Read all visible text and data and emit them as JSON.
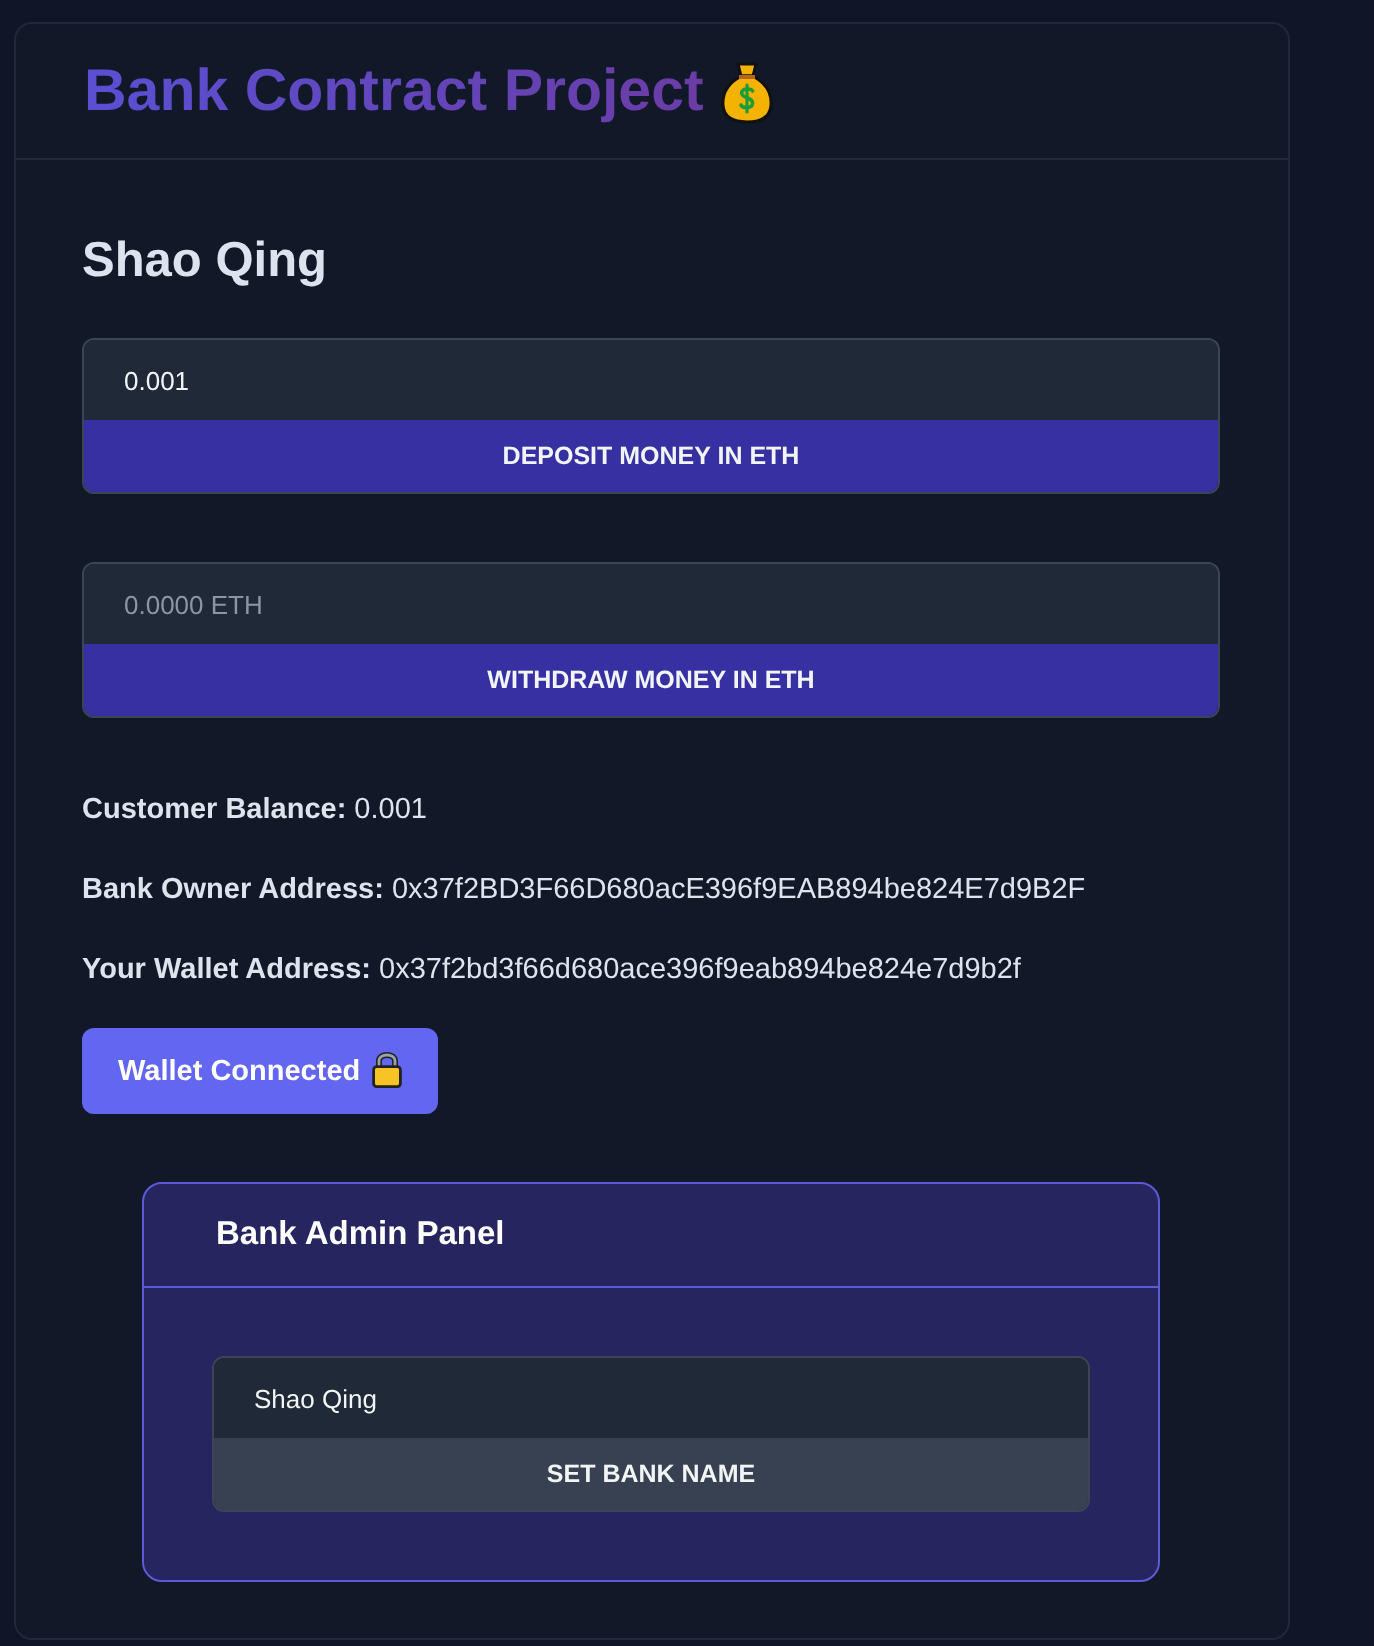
{
  "header": {
    "title": "Bank Contract Project"
  },
  "bank_name": "Shao Qing",
  "forms": [
    {
      "value": "0.001",
      "button": "DEPOSIT MONEY IN ETH"
    },
    {
      "placeholder": "0.0000 ETH",
      "button": "WITHDRAW MONEY IN ETH"
    }
  ],
  "details": [
    {
      "label": "Customer Balance:",
      "value": "0.001"
    },
    {
      "label": "Bank Owner Address:",
      "value": "0x37f2BD3F66D680acE396f9EAB894be824E7d9B2F"
    },
    {
      "label": "Your Wallet Address:",
      "value": "0x37f2bd3f66d680ace396f9eab894be824e7d9b2f"
    }
  ],
  "wallet_button": {
    "label": "Wallet Connected"
  },
  "admin_panel": {
    "title": "Bank Admin Panel",
    "form": {
      "value": "Shao Qing",
      "button": "SET BANK NAME"
    }
  }
}
